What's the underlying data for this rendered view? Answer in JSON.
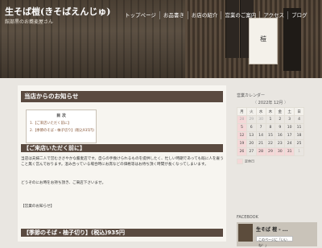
{
  "header": {
    "site_title": "生そば榿(きそばえんじゅ)",
    "site_desc": "館部黒のお蕎麦屋さん",
    "sign_text": "榿"
  },
  "nav": [
    {
      "label": "トップページ"
    },
    {
      "label": "お品書き"
    },
    {
      "label": "お店の紹介"
    },
    {
      "label": "営業のご案内"
    },
    {
      "label": "アクセス"
    },
    {
      "label": "ブログ"
    }
  ],
  "main": {
    "title": "当店からのお知らせ",
    "toc": {
      "title": "目 次",
      "items": [
        "1.【ご来店いただく前に】",
        "2.【季節のそば・柚子切り】(税込935円)"
      ]
    },
    "section1": "【ご来店いただく前に】",
    "para1": "当店は夫婦二人で営むささやかな蕎麦店です。自らの手挽けられるものを提供したく、忙しい時期であっても既に人を雇うこと無く営んでおります。混み合っている場合時にお席などの価格等はお待ち頂く時間が長くなってしまいます。",
    "para2": "どうぞのにお時をお持ち頂き、ご来店下さいませ。",
    "notice": "【営業のお知らせ】",
    "section2": "【季節のそば・柚子切り】(税込)935円"
  },
  "sidebar": {
    "calendar_title": "営業カレンダー",
    "calendar": {
      "prev": "〈",
      "next": "〉",
      "month": "2022年 12月",
      "weekdays": [
        "月",
        "火",
        "水",
        "木",
        "金",
        "土",
        "日"
      ],
      "weeks": [
        [
          "28",
          "29",
          "30",
          "1",
          "2",
          "3",
          "4"
        ],
        [
          "5",
          "6",
          "7",
          "8",
          "9",
          "10",
          "11"
        ],
        [
          "12",
          "13",
          "14",
          "15",
          "16",
          "17",
          "18"
        ],
        [
          "19",
          "20",
          "21",
          "22",
          "23",
          "24",
          "25"
        ],
        [
          "26",
          "27",
          "28",
          "29",
          "30",
          "31",
          "1"
        ]
      ],
      "legend": "定休日"
    },
    "facebook_title": "FACEBOOK",
    "facebook_name": "生そば 榿 - ...",
    "facebook_like": "このページに「いいね！」"
  }
}
